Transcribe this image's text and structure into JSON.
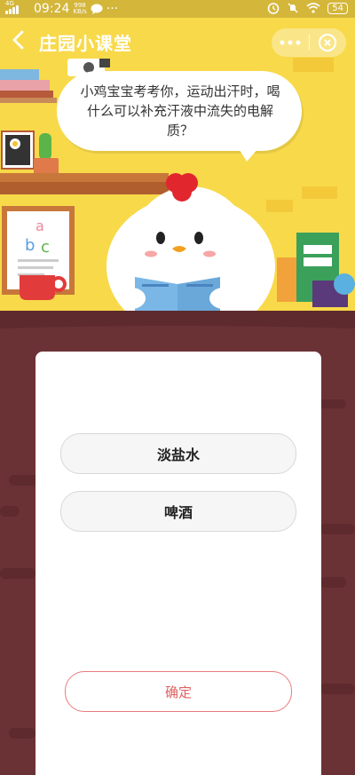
{
  "status_bar": {
    "network": "4G",
    "time": "09:24",
    "speed_value": "998",
    "speed_unit": "KB/s",
    "chat_icon": "chat-bubble-icon",
    "more": "···",
    "battery": "54"
  },
  "nav": {
    "title": "庄园小课堂",
    "back_icon": "chevron-left-icon",
    "more_icon": "more-dots-icon",
    "close_icon": "circle-close-icon"
  },
  "quiz": {
    "question": "小鸡宝宝考考你，运动出汗时，喝什么可以补充汗液中流失的电解质？",
    "options": [
      {
        "label": "淡盐水"
      },
      {
        "label": "啤酒"
      }
    ],
    "confirm_label": "确定"
  },
  "illustration": {
    "letters": [
      "a",
      "b",
      "c"
    ]
  },
  "colors": {
    "scene_bg": "#f8d94a",
    "board_bg": "#6b3235",
    "accent": "#e06060"
  }
}
